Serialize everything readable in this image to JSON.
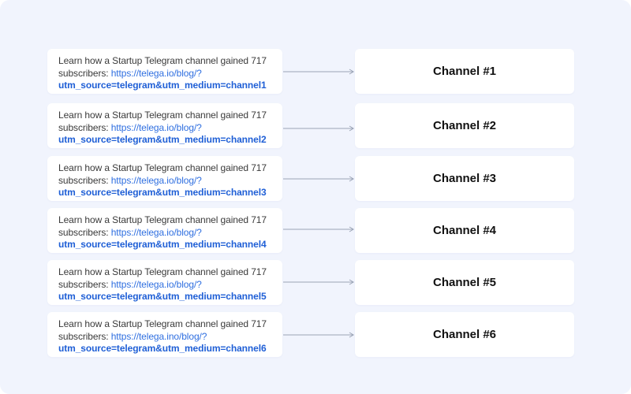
{
  "rows": [
    {
      "post": {
        "line1": "Learn how a Startup Telegram channel gained 717",
        "prefix": "subscribers: ",
        "link_start": "https://telega.io/blog/?",
        "link_params": "utm_source=telegram&utm_medium=channel1"
      },
      "channel": "Channel #1"
    },
    {
      "post": {
        "line1": "Learn how a Startup Telegram channel gained 717",
        "prefix": "subscribers: ",
        "link_start": "https://telega.io/blog/?",
        "link_params": "utm_source=telegram&utm_medium=channel2"
      },
      "channel": "Channel #2"
    },
    {
      "post": {
        "line1": "Learn how a Startup Telegram channel gained 717",
        "prefix": "subscribers: ",
        "link_start": "https://telega.io/blog/?",
        "link_params": "utm_source=telegram&utm_medium=channel3"
      },
      "channel": "Channel #3"
    },
    {
      "post": {
        "line1": "Learn how a Startup Telegram channel gained 717",
        "prefix": "subscribers: ",
        "link_start": "https://telega.io/blog/?",
        "link_params": "utm_source=telegram&utm_medium=channel4"
      },
      "channel": "Channel #4"
    },
    {
      "post": {
        "line1": "Learn how a Startup Telegram channel gained 717",
        "prefix": "subscribers: ",
        "link_start": "https://telega.io/blog/?",
        "link_params": "utm_source=telegram&utm_medium=channel5"
      },
      "channel": "Channel #5"
    },
    {
      "post": {
        "line1": "Learn how a Startup Telegram channel gained 717",
        "prefix": "subscribers: ",
        "link_start": "https://telega.ino/blog/?",
        "link_params": "utm_source=telegram&utm_medium=channel6"
      },
      "channel": "Channel #6"
    }
  ],
  "colors": {
    "background": "#f1f4fd",
    "card": "#ffffff",
    "link": "#2f6fe0",
    "arrow": "#9aa3b5"
  }
}
